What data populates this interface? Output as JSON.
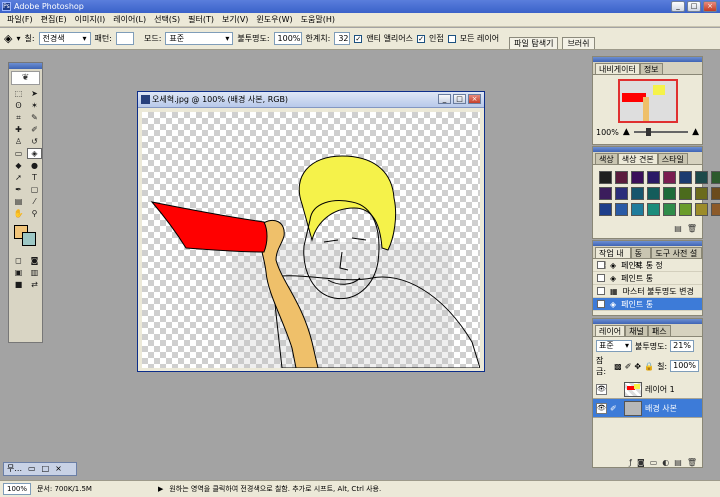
{
  "app": {
    "title": "Adobe Photoshop",
    "minimize": "_",
    "maximize": "□",
    "close": "×"
  },
  "menu": [
    "파일(F)",
    "편집(E)",
    "이미지(I)",
    "레이어(L)",
    "선택(S)",
    "필터(T)",
    "보기(V)",
    "윈도우(W)",
    "도움말(H)"
  ],
  "options": {
    "fill_label": "칠:",
    "fill_value": "전경색",
    "pattern_label": "패턴:",
    "mode_label": "모드:",
    "mode_value": "표준",
    "opacity_label": "불투명도:",
    "opacity_value": "100%",
    "tolerance_label": "한계치:",
    "tolerance_value": "32",
    "antialias": "앤티 앨리어스",
    "contiguous": "인접",
    "all_layers": "모든 레이어",
    "well_tabs": [
      "파일 탐색기",
      "브러쉬"
    ]
  },
  "document": {
    "title": "오세혁.jpg @ 100% (배경 사본, RGB)",
    "min": "_",
    "max": "□",
    "close": "×"
  },
  "navigator": {
    "tabs": [
      "내비게이터",
      "정보"
    ],
    "zoom": "100%"
  },
  "swatches_panel": {
    "tabs": [
      "색상",
      "색상 견본",
      "스타일"
    ],
    "colors": [
      "#1f1f1f",
      "#5b1b3d",
      "#3b0f5a",
      "#2a1a66",
      "#7a1d50",
      "#1b3b70",
      "#1d4a4a",
      "#2c5a2c",
      "#3b1d5c",
      "#2b2e7a",
      "#17556d",
      "#145c5b",
      "#1d6b3a",
      "#4b6b1d",
      "#6b6b1d",
      "#6b4b1d",
      "#1d3d8a",
      "#2a5aa5",
      "#1f7c9c",
      "#1b8c7b",
      "#2f8c4a",
      "#6a9c2a",
      "#9c8c2a",
      "#8c5a2a"
    ]
  },
  "history": {
    "tabs": [
      "작업 내역",
      "동작",
      "도구 사전 설정"
    ],
    "items": [
      "페인트 통",
      "페인트 통",
      "마스터 불투명도 변경",
      "페인트 통"
    ],
    "selected_index": 3
  },
  "layers": {
    "tabs": [
      "레이어",
      "채널",
      "패스"
    ],
    "blend_mode": "표준",
    "opacity_label": "불투명도:",
    "opacity_value": "21%",
    "lock_label": "잠금:",
    "fill_label": "칠:",
    "fill_value": "100%",
    "items": [
      {
        "name": "레이어 1",
        "selected": false
      },
      {
        "name": "배경 사본",
        "selected": true
      }
    ]
  },
  "statusbar": {
    "zoom": "100%",
    "doc_info": "문서: 700K/1.5M",
    "hint": "원하는 영역을 클릭하여 전경색으로 칠함. 추가로 시프트, Alt, Ctrl 사용."
  },
  "task_mini": {
    "label": "무..."
  },
  "colors": {
    "foreground": "#f1c57a",
    "background": "#9cc7c5",
    "title_blue": "#3a62c9",
    "selection_blue": "#3d7bd8"
  }
}
